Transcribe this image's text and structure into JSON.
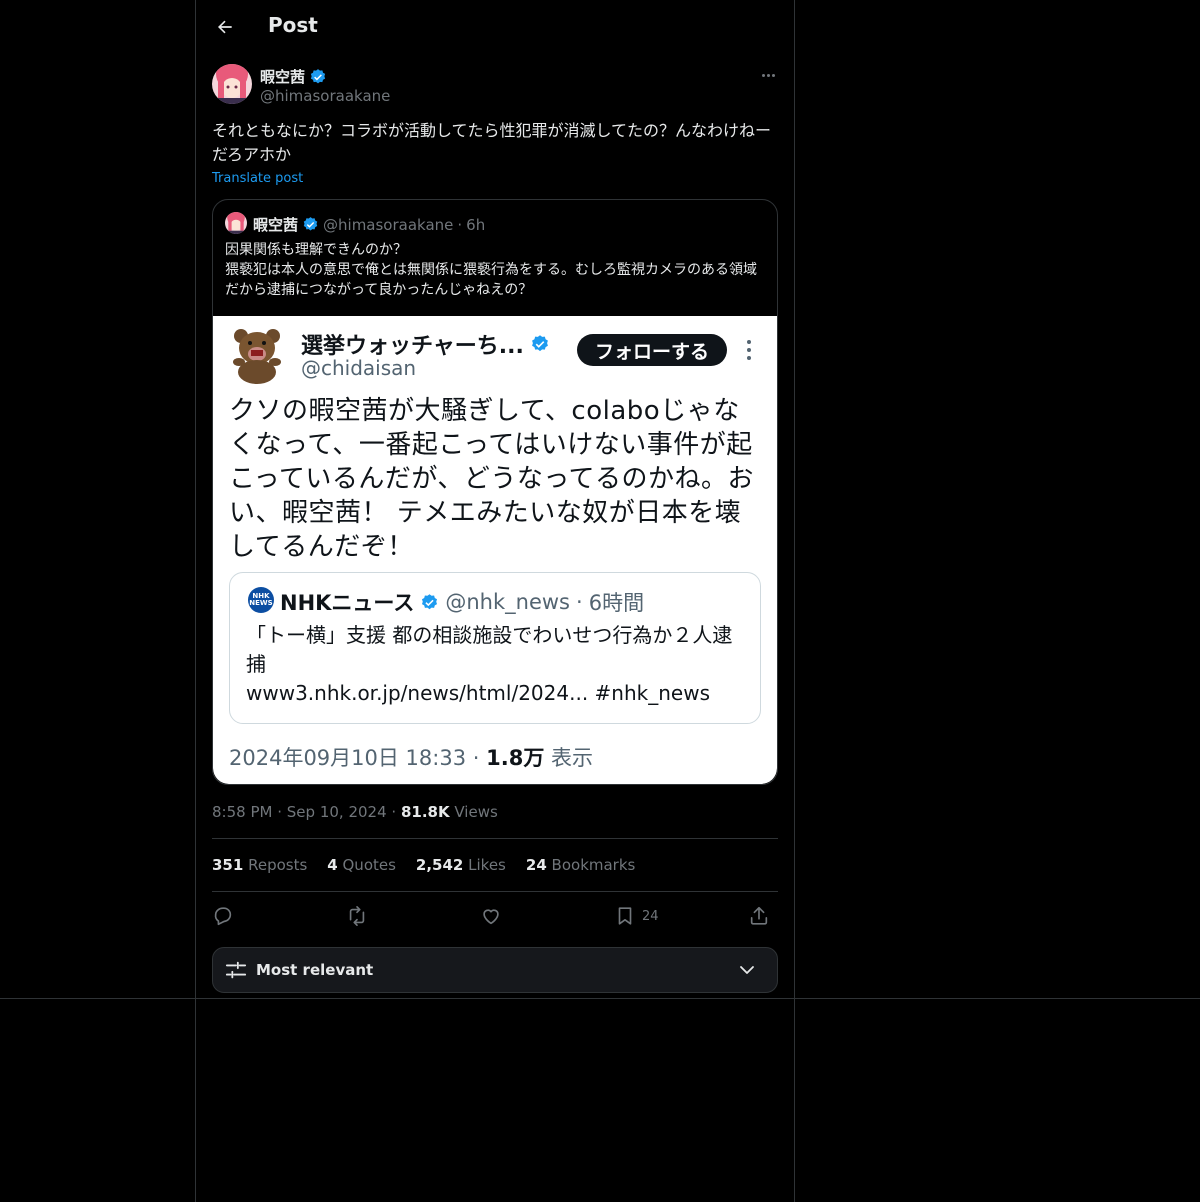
{
  "header": {
    "title": "Post"
  },
  "post": {
    "author_name": "暇空茜",
    "author_handle": "@himasoraakane",
    "text": "それともなにか？コラボが活動してたら性犯罪が消滅してたの？んなわけねーだろアホか",
    "translate_label": "Translate post",
    "time": "8:58 PM",
    "date": "Sep 10, 2024",
    "views_count": "81.8K",
    "views_label": "Views"
  },
  "quote": {
    "author_name": "暇空茜",
    "author_handle": "@himasoraakane",
    "age": "6h",
    "lines": [
      "因果関係も理解できんのか？",
      "猥褻犯は本人の意思で俺とは無関係に猥褻行為をする。むしろ監視カメラのある領域だから逮捕につながって良かったんじゃねえの？"
    ]
  },
  "screenshot": {
    "name": "選挙ウォッチャーち...",
    "handle": "@chidaisan",
    "follow_label": "フォローする",
    "text": "クソの暇空茜が大騒ぎして、colaboじゃなくなって、一番起こってはいけない事件が起こっているんだが、どうなってるのかね。おい、暇空茜！ テメエみたいな奴が日本を壊してるんだぞ！",
    "nested": {
      "logo_text": "NHK NEWS",
      "name": "NHKニュース",
      "handle": "@nhk_news",
      "age": "6時間",
      "headline": "「トー横」支援 都の相談施設でわいせつ行為か２人逮捕",
      "link": "www3.nhk.or.jp/news/html/2024... #nhk_news"
    },
    "timestamp": "2024年09月10日 18:33",
    "views_count": "1.8万",
    "views_label": "表示"
  },
  "stats": {
    "reposts_count": "351",
    "reposts_label": "Reposts",
    "quotes_count": "4",
    "quotes_label": "Quotes",
    "likes_count": "2,542",
    "likes_label": "Likes",
    "bookmarks_count": "24",
    "bookmarks_label": "Bookmarks"
  },
  "actions": {
    "bookmark_count": "24"
  },
  "sort": {
    "label": "Most relevant"
  },
  "colors": {
    "accent": "#1d9bf0",
    "background": "#000000",
    "border": "#2f3336",
    "muted": "#71767b"
  }
}
